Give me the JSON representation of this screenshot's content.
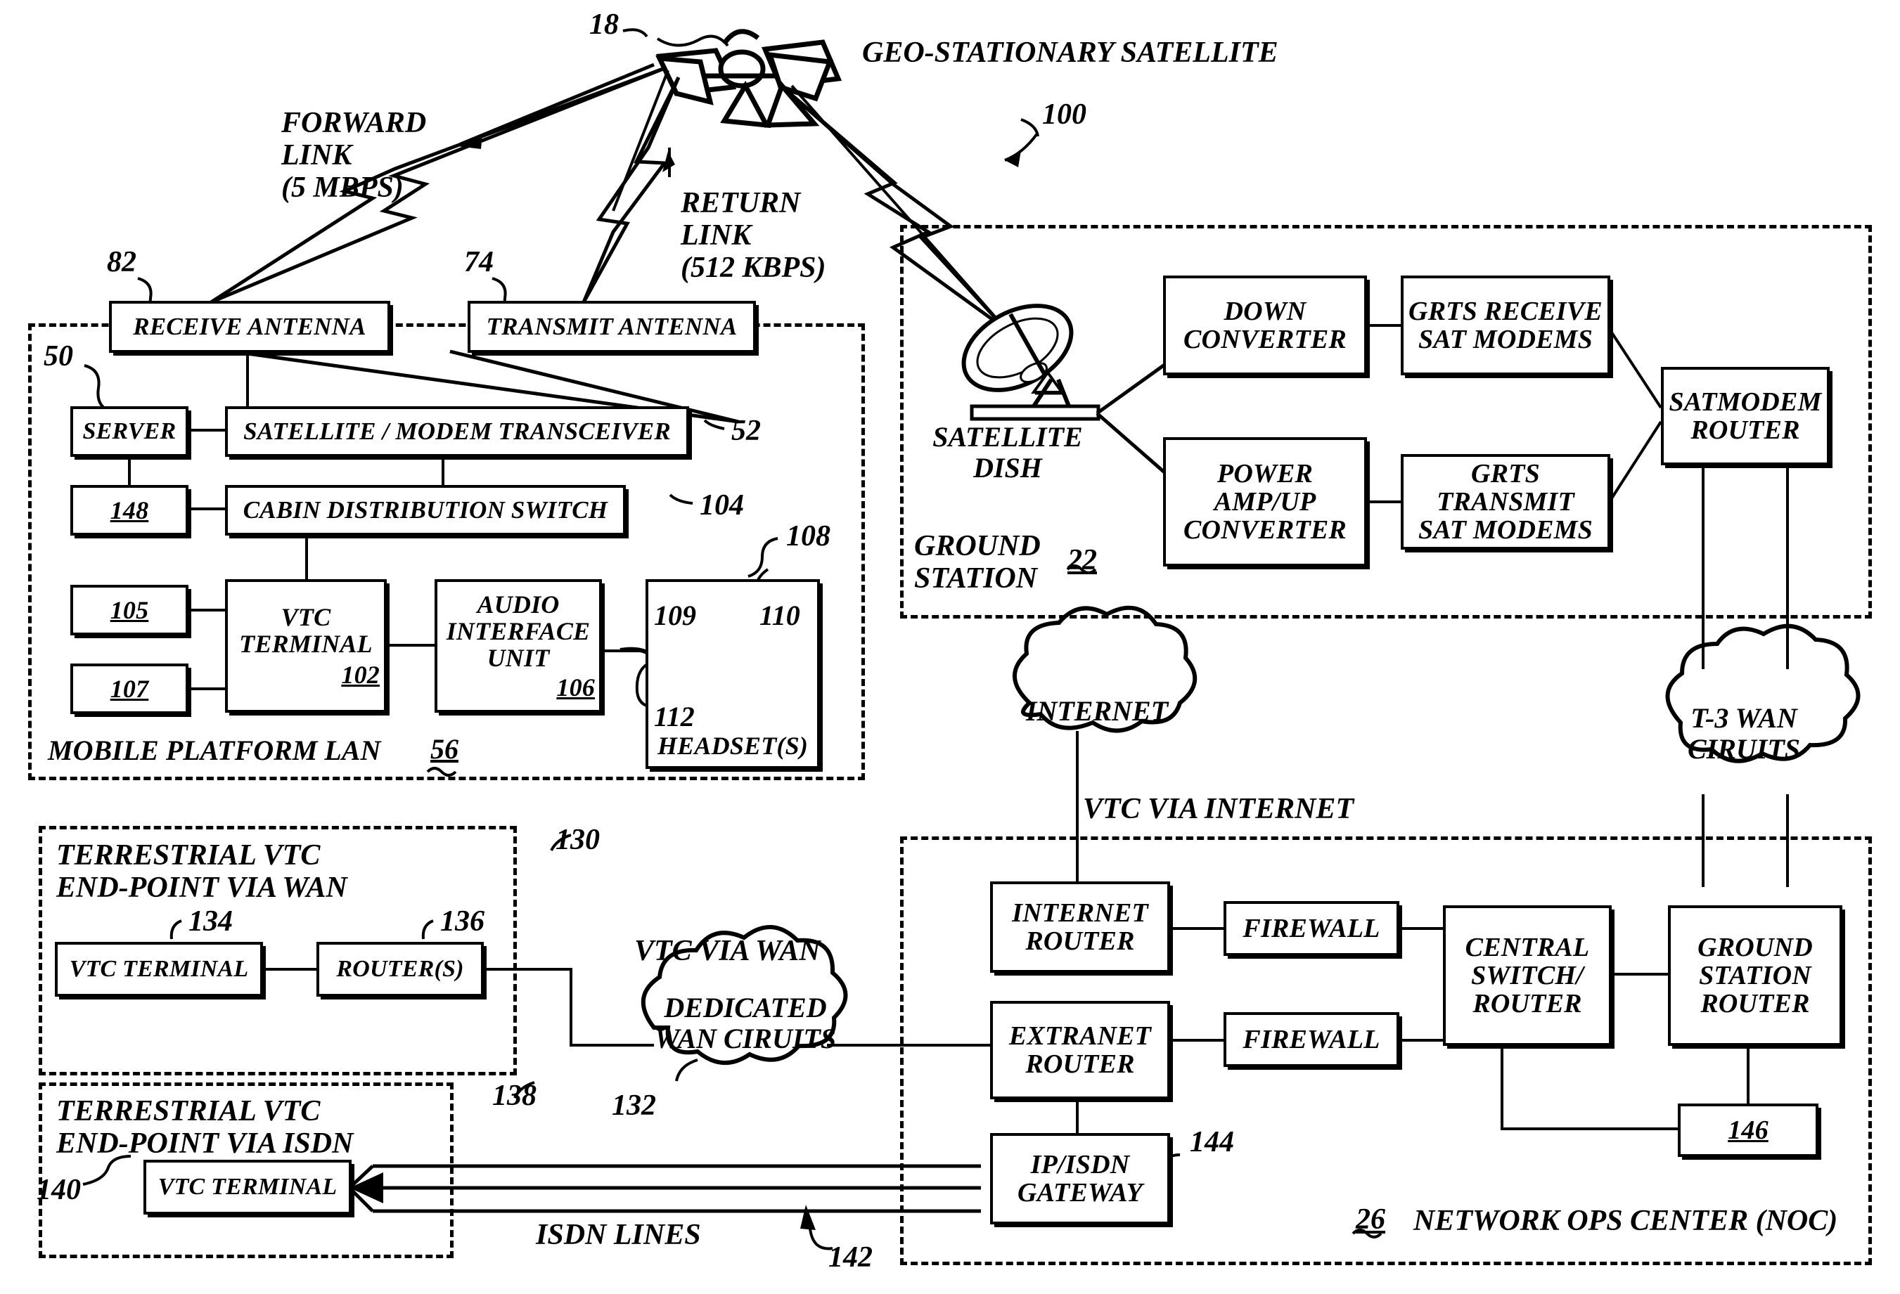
{
  "figure": {
    "ref_100": "100",
    "satellite_ref": "18",
    "satellite_title": "GEO-STATIONARY SATELLITE",
    "forward_link": "FORWARD\nLINK\n(5 MBPS)",
    "return_link": "RETURN\nLINK\n(512 KBPS)"
  },
  "mobile_platform": {
    "region_label": "MOBILE PLATFORM LAN",
    "region_ref": "56",
    "ref_50": "50",
    "receive_antenna": {
      "label": "RECEIVE ANTENNA",
      "ref": "82"
    },
    "transmit_antenna": {
      "label": "TRANSMIT ANTENNA",
      "ref": "74"
    },
    "server": {
      "label": "SERVER"
    },
    "transceiver": {
      "label": "SATELLITE / MODEM TRANSCEIVER",
      "ref": "52"
    },
    "box_148": {
      "label": "148"
    },
    "cabin_switch": {
      "label": "CABIN DISTRIBUTION SWITCH",
      "ref": "104"
    },
    "box_105": {
      "label": "105"
    },
    "box_107": {
      "label": "107"
    },
    "vtc_terminal": {
      "label": "VTC\nTERMINAL",
      "ref": "102"
    },
    "audio_interface": {
      "label": "AUDIO\nINTERFACE\nUNIT",
      "ref": "106"
    },
    "headset": {
      "label": "HEADSET(S)",
      "ref": "108",
      "ref_earpiece": "109",
      "ref_mic": "110",
      "ref_cord": "112"
    }
  },
  "ground_station": {
    "region_label": "GROUND\nSTATION",
    "region_ref": "22",
    "satellite_dish": "SATELLITE\nDISH",
    "down_converter": "DOWN\nCONVERTER",
    "power_amp": "POWER\nAMP/UP\nCONVERTER",
    "grts_receive": "GRTS RECEIVE\nSAT MODEMS",
    "grts_transmit": "GRTS TRANSMIT\nSAT MODEMS",
    "satmodem_router": "SATMODEM\nROUTER"
  },
  "clouds": {
    "internet": "INTERNET",
    "dedicated_wan": "DEDICATED\nWAN CIRUITS",
    "dedicated_wan_ref": "132",
    "t3_wan": "T-3 WAN\nCIRUITS"
  },
  "link_captions": {
    "vtc_via_internet": "VTC VIA INTERNET",
    "vtc_via_wan": "VTC VIA WAN",
    "isdn_lines": "ISDN LINES",
    "isdn_lines_ref": "142"
  },
  "terrestrial_wan": {
    "region_label": "TERRESTRIAL VTC\nEND-POINT VIA WAN",
    "region_ref": "130",
    "vtc_terminal": {
      "label": "VTC TERMINAL",
      "ref": "134"
    },
    "routers": {
      "label": "ROUTER(S)",
      "ref": "136"
    }
  },
  "terrestrial_isdn": {
    "region_label": "TERRESTRIAL VTC\nEND-POINT VIA ISDN",
    "region_ref": "138",
    "vtc_terminal": {
      "label": "VTC TERMINAL",
      "ref": "140"
    }
  },
  "noc": {
    "region_label": "NETWORK OPS CENTER (NOC)",
    "region_ref": "26",
    "internet_router": "INTERNET\nROUTER",
    "extranet_router": "EXTRANET\nROUTER",
    "firewall_top": "FIREWALL",
    "firewall_bottom": "FIREWALL",
    "central_switch": "CENTRAL\nSWITCH/\nROUTER",
    "ground_station_router": "GROUND\nSTATION\nROUTER",
    "ip_isdn_gateway": {
      "label": "IP/ISDN\nGATEWAY",
      "ref": "144"
    },
    "box_146": {
      "label": "146"
    }
  },
  "colors": {
    "ink": "#000000",
    "paper": "#ffffff"
  }
}
